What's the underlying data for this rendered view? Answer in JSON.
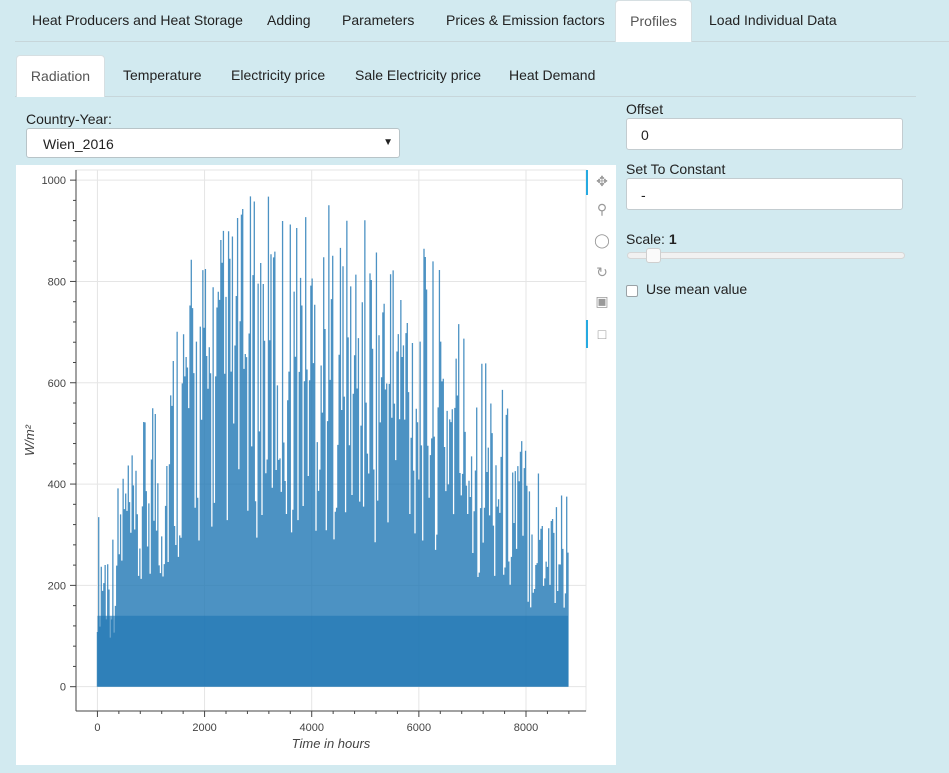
{
  "top_tabs": [
    {
      "label": "Heat Producers and Heat Storage",
      "active": false
    },
    {
      "label": "Adding",
      "active": false
    },
    {
      "label": "Parameters",
      "active": false
    },
    {
      "label": "Prices & Emission factors",
      "active": false
    },
    {
      "label": "Profiles",
      "active": true
    },
    {
      "label": "Load Individual Data",
      "active": false
    }
  ],
  "sub_tabs": [
    {
      "label": "Radiation",
      "active": true
    },
    {
      "label": "Temperature",
      "active": false
    },
    {
      "label": "Electricity price",
      "active": false
    },
    {
      "label": "Sale Electricity price",
      "active": false
    },
    {
      "label": "Heat Demand",
      "active": false
    }
  ],
  "country_year": {
    "label": "Country-Year:",
    "value": "Wien_2016"
  },
  "offset": {
    "label": "Offset",
    "value": "0"
  },
  "set_constant": {
    "label": "Set To Constant",
    "value": "-"
  },
  "scale": {
    "label": "Scale:",
    "value": "1"
  },
  "mean_value": {
    "label": "Use mean value",
    "checked": false
  },
  "toolbar": [
    "pan-icon",
    "box-zoom-icon",
    "wheel-zoom-icon",
    "reset-icon",
    "save-icon",
    "hover-icon"
  ],
  "colors": {
    "series": "#1f77b4",
    "background": "#d2eaf0"
  },
  "chart_data": {
    "type": "area",
    "title": "",
    "xlabel": "Time in hours",
    "ylabel": "W/m²",
    "xlim": [
      -400,
      9120
    ],
    "ylim": [
      -48,
      1020
    ],
    "xticks": [
      0,
      2000,
      4000,
      6000,
      8000
    ],
    "yticks": [
      0,
      200,
      400,
      600,
      800,
      1000
    ],
    "grid": true,
    "legend": "none",
    "series": [
      {
        "x": [
          0,
          250,
          500,
          750,
          1000,
          1250,
          1500,
          1750,
          2000,
          2250,
          2500,
          2750,
          3000,
          3250,
          3500,
          3750,
          4000,
          4250,
          4500,
          4750,
          5000,
          5250,
          5500,
          5750,
          6000,
          6250,
          6500,
          6750,
          7000,
          7250,
          7500,
          7750,
          8000,
          8250,
          8500,
          8784
        ],
        "values": [
          360,
          300,
          510,
          420,
          660,
          560,
          820,
          860,
          880,
          920,
          960,
          965,
          980,
          980,
          975,
          980,
          980,
          970,
          965,
          920,
          940,
          930,
          920,
          910,
          880,
          860,
          810,
          780,
          710,
          690,
          620,
          560,
          510,
          470,
          440,
          410
        ]
      }
    ]
  }
}
